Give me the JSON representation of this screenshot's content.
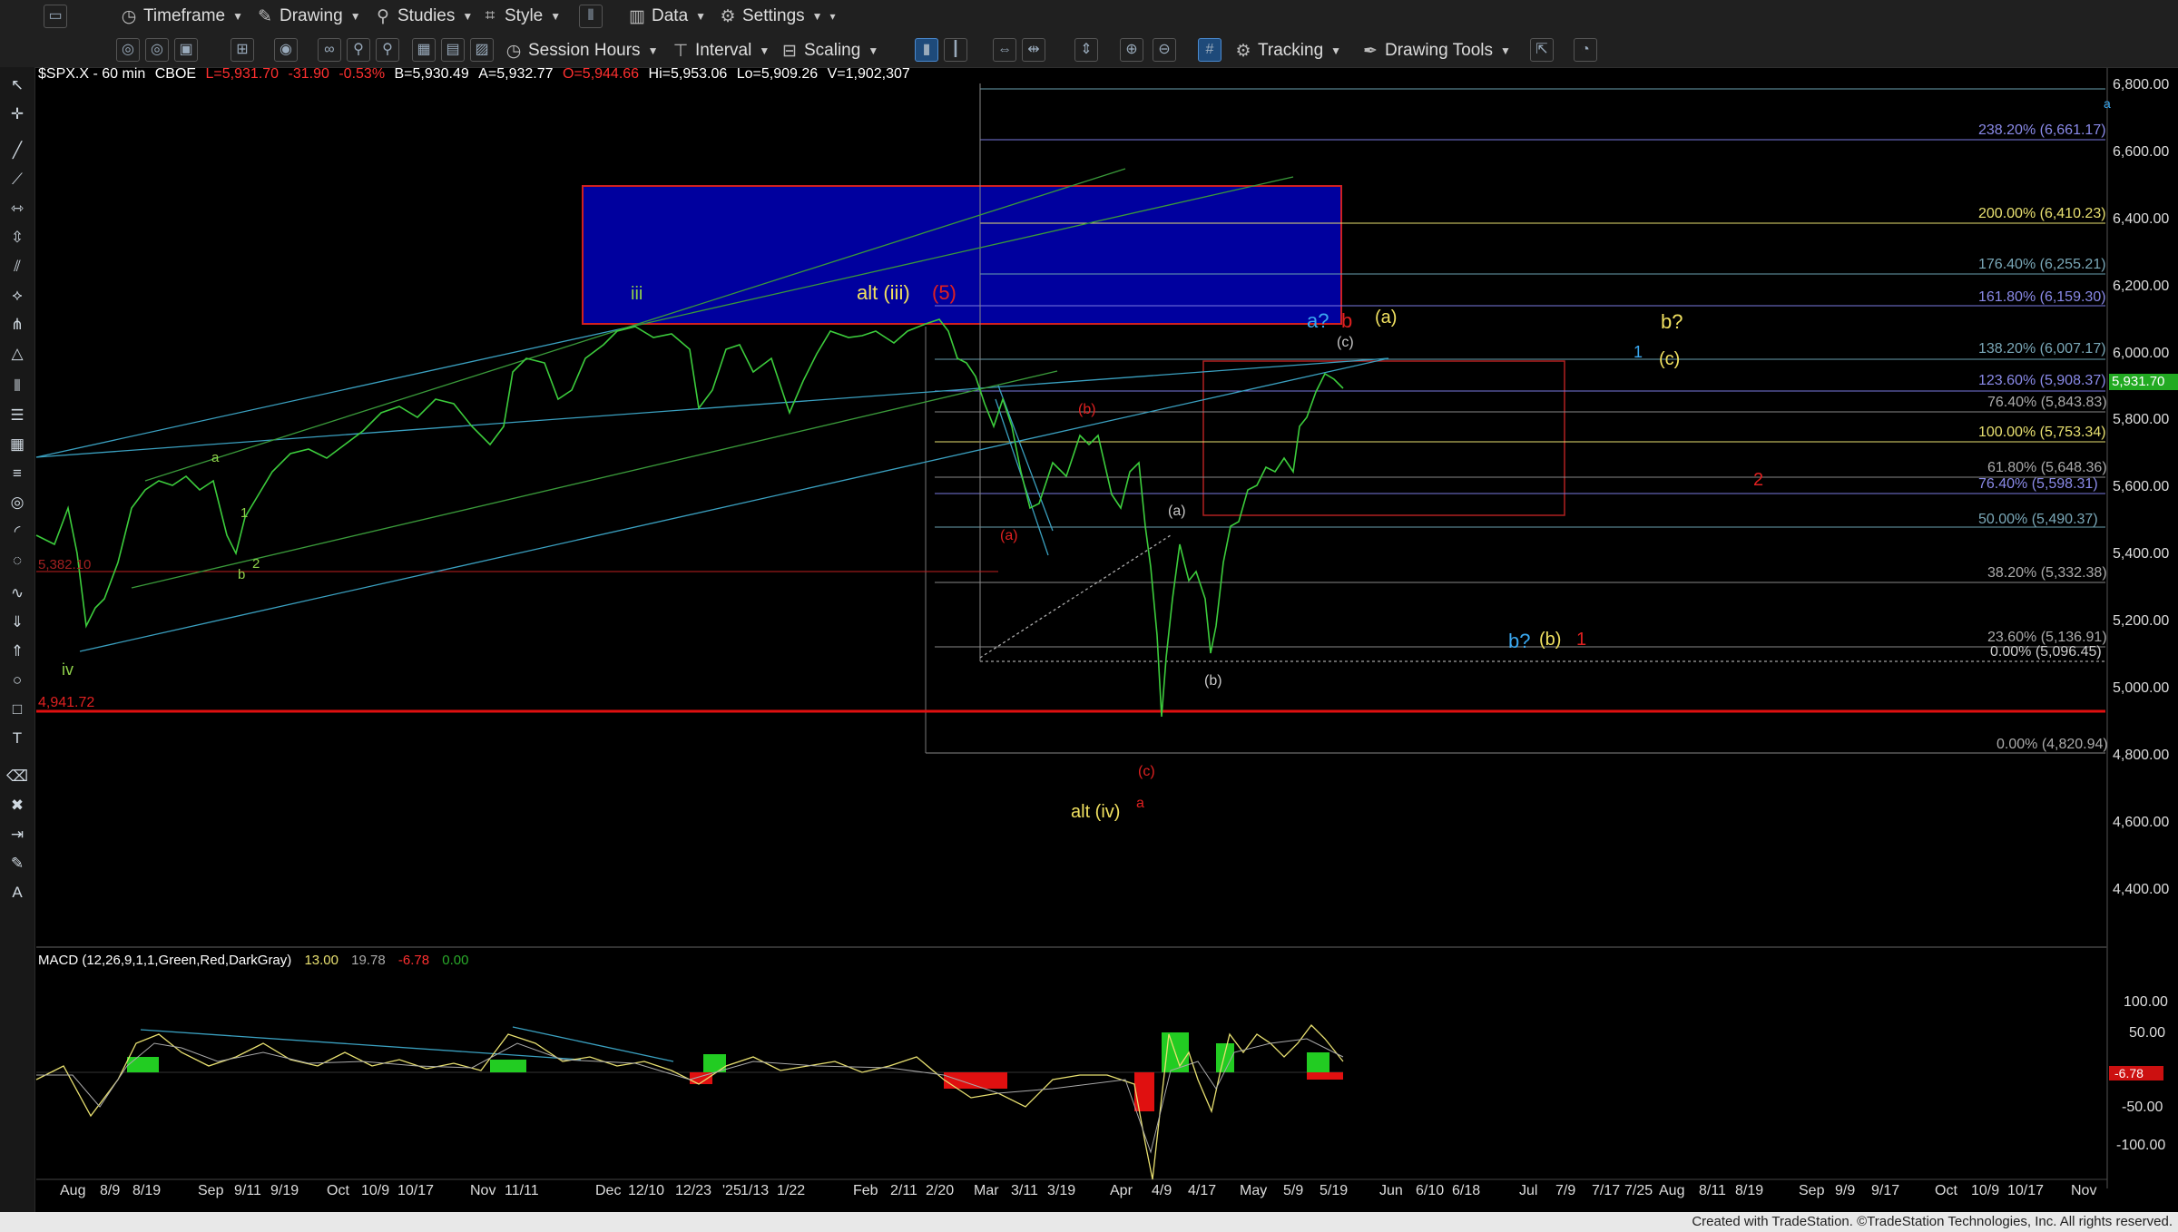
{
  "toolbar": {
    "timeframe": "Timeframe",
    "drawing": "Drawing",
    "studies": "Studies",
    "style": "Style",
    "data": "Data",
    "settings": "Settings",
    "session_hours": "Session Hours",
    "interval": "Interval",
    "scaling": "Scaling",
    "tracking": "Tracking",
    "drawing_tools": "Drawing Tools"
  },
  "chart_info": {
    "symbol": "$SPX.X - 60 min",
    "exchange": "CBOE",
    "last": "L=5,931.70",
    "change": "-31.90",
    "change_pct": "-0.53%",
    "bid": "B=5,930.49",
    "ask": "A=5,932.77",
    "open": "O=5,944.66",
    "high": "Hi=5,953.06",
    "low": "Lo=5,909.26",
    "volume": "V=1,902,307",
    "last_price_tag": "5,931.70"
  },
  "macd": {
    "label": "MACD (12,26,9,1,1,Green,Red,DarkGray)",
    "v1": "13.00",
    "v2": "19.78",
    "v3": "-6.78",
    "v4": "0.00",
    "tag": "-6.78",
    "axis_labels": [
      "100.00",
      "50.00",
      "-50.00",
      "-100.00"
    ]
  },
  "price_axis": [
    "6,800.00",
    "6,600.00",
    "6,400.00",
    "6,200.00",
    "6,000.00",
    "5,800.00",
    "5,600.00",
    "5,400.00",
    "5,200.00",
    "5,000.00",
    "4,800.00",
    "4,600.00",
    "4,400.00"
  ],
  "date_axis": [
    "Aug",
    "8/9",
    "8/19",
    "Sep",
    "9/11",
    "9/19",
    "Oct",
    "10/9",
    "10/17",
    "Nov",
    "11/11",
    "Dec",
    "12/10",
    "12/23",
    "'25",
    "1/13",
    "1/22",
    "Feb",
    "2/11",
    "2/20",
    "Mar",
    "3/11",
    "3/19",
    "Apr",
    "4/9",
    "4/17",
    "May",
    "5/9",
    "5/19",
    "Jun",
    "6/10",
    "6/18",
    "Jul",
    "7/9",
    "7/17",
    "7/25",
    "Aug",
    "8/11",
    "8/19",
    "Sep",
    "9/9",
    "9/17",
    "Oct",
    "10/9",
    "10/17",
    "Nov"
  ],
  "fib_labels": [
    {
      "text": "238.20% (6,661.17)",
      "color": "#8a8ae8"
    },
    {
      "text": "200.00% (6,410.23)",
      "color": "#e8e070"
    },
    {
      "text": "176.40% (6,255.21)",
      "color": "#7aa8b8"
    },
    {
      "text": "161.80% (6,159.30)",
      "color": "#8a8ae8"
    },
    {
      "text": "138.20% (6,007.17)",
      "color": "#7aa8b8"
    },
    {
      "text": "123.60% (5,908.37)",
      "color": "#8a8ae8"
    },
    {
      "text": "76.40% (5,843.83)",
      "color": "#aaaaaa"
    },
    {
      "text": "100.00% (5,753.34)",
      "color": "#e8e070"
    },
    {
      "text": "61.80% (5,648.36)",
      "color": "#aaaaaa"
    },
    {
      "text": "76.40% (5,598.31)",
      "color": "#8a8ae8"
    },
    {
      "text": "50.00% (5,490.37)",
      "color": "#7aa8b8"
    },
    {
      "text": "38.20% (5,332.38)",
      "color": "#aaaaaa"
    },
    {
      "text": "23.60% (5,136.91)",
      "color": "#aaaaaa"
    },
    {
      "text": "0.00% (5,096.45)",
      "color": "#cccccc"
    },
    {
      "text": "0.00% (4,820.94)",
      "color": "#aaaaaa"
    }
  ],
  "wave_labels": [
    {
      "text": "iii",
      "color": "#8ed04a"
    },
    {
      "text": "alt (iii)",
      "color": "#f0e060"
    },
    {
      "text": "(5)",
      "color": "#e02020"
    },
    {
      "text": "a?",
      "color": "#3aa8f0"
    },
    {
      "text": "b",
      "color": "#e02020"
    },
    {
      "text": "(a)",
      "color": "#f0e060"
    },
    {
      "text": "(c)",
      "color": "#c8c8c8"
    },
    {
      "text": "b?",
      "color": "#f0e060"
    },
    {
      "text": "1",
      "color": "#3aa8f0"
    },
    {
      "text": "(c)",
      "color": "#f0e060"
    },
    {
      "text": "2",
      "color": "#e02020"
    },
    {
      "text": "b?",
      "color": "#3aa8f0"
    },
    {
      "text": "(b)",
      "color": "#f0e060"
    },
    {
      "text": "1",
      "color": "#e02020"
    },
    {
      "text": "(b)",
      "color": "#e02020"
    },
    {
      "text": "(a)",
      "color": "#e02020"
    },
    {
      "text": "(a)",
      "color": "#c8c8c8"
    },
    {
      "text": "(b)",
      "color": "#c8c8c8"
    },
    {
      "text": "(c)",
      "color": "#e02020"
    },
    {
      "text": "a",
      "color": "#e02020"
    },
    {
      "text": "alt (iv)",
      "color": "#f0e060"
    },
    {
      "text": "iv",
      "color": "#8ed04a"
    },
    {
      "text": "a",
      "color": "#8ed04a"
    },
    {
      "text": "1",
      "color": "#8ed04a"
    },
    {
      "text": "2",
      "color": "#8ed04a"
    },
    {
      "text": "b",
      "color": "#8ed04a"
    },
    {
      "text": "a",
      "color": "#3aa8f0"
    }
  ],
  "level_labels": {
    "support": "4,941.72",
    "left_marker": "5,382.10"
  },
  "footer": "Created with TradeStation. ©TradeStation Technologies, Inc. All rights reserved."
}
